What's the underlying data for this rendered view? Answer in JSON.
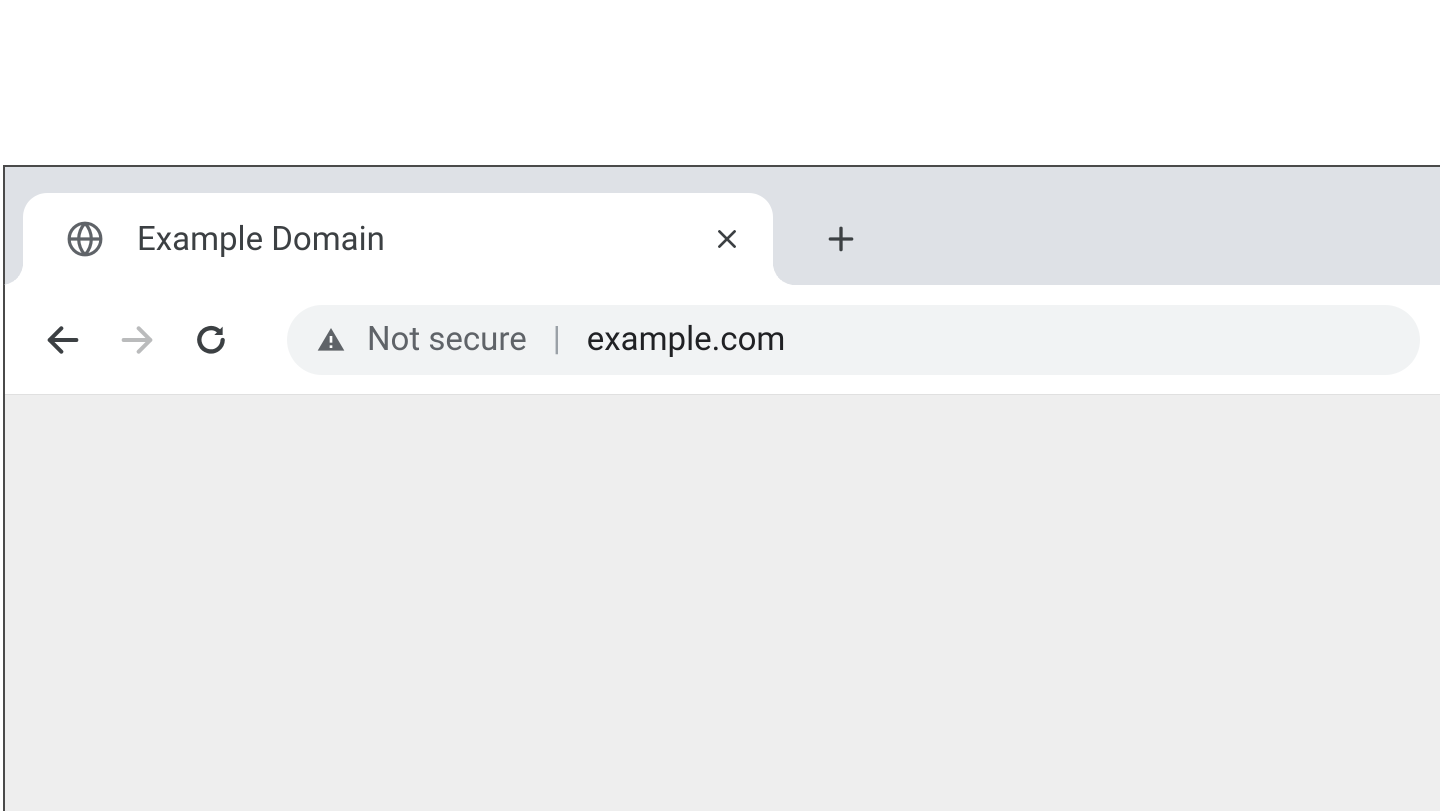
{
  "tab": {
    "title": "Example Domain",
    "favicon": "globe-icon"
  },
  "addressbar": {
    "security_label": "Not secure",
    "url": "example.com"
  }
}
